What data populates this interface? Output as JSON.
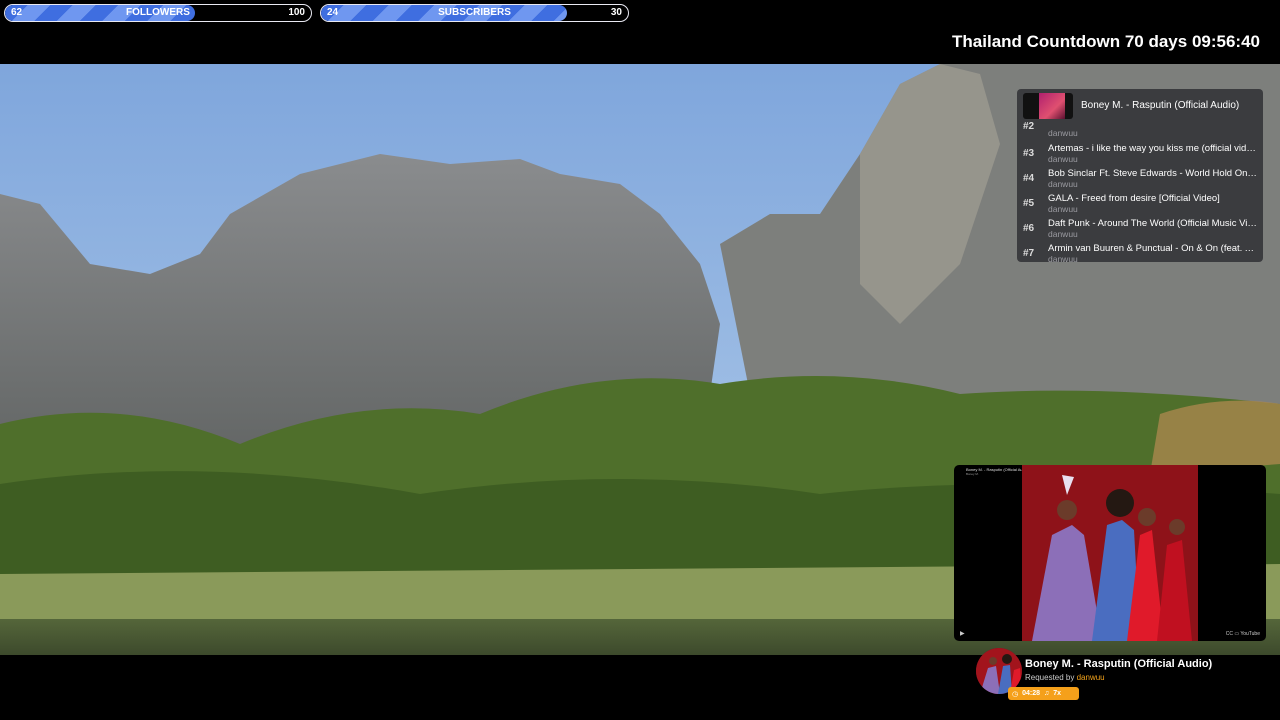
{
  "goals": {
    "followers": {
      "current": "62",
      "label": "FOLLOWERS",
      "max": "100",
      "progress": 0.62
    },
    "subscribers": {
      "current": "24",
      "label": "SUBSCRIBERS",
      "max": "30",
      "progress": 0.8
    }
  },
  "countdown": {
    "text": "Thailand Countdown 70 days 09:56:40"
  },
  "queue": {
    "now_playing": {
      "title": "Boney M. - Rasputin (Official Audio)"
    },
    "items": [
      {
        "num": "#2",
        "title": "",
        "user": "danwuu"
      },
      {
        "num": "#3",
        "title": "Artemas - i like the way you kiss me (official video)",
        "user": "danwuu"
      },
      {
        "num": "#4",
        "title": "Bob Sinclar Ft. Steve Edwards - World Hold On (Official Video)",
        "user": "danwuu"
      },
      {
        "num": "#5",
        "title": "GALA - Freed from desire [Official Video]",
        "user": "danwuu"
      },
      {
        "num": "#6",
        "title": "Daft Punk - Around The World (Official Music Video)",
        "user": "danwuu"
      },
      {
        "num": "#7",
        "title": "Armin van Buuren & Punctual - On & On (feat. Alika)",
        "user": "danwuu"
      }
    ]
  },
  "player": {
    "video_title": "Boney M. - Rasputin (Official Audio)",
    "video_sub": "Boney M.",
    "controls_right": "CC ▭ YouTube"
  },
  "now_card": {
    "title": "Boney M. - Rasputin (Official Audio)",
    "requested_prefix": "Requested by",
    "requested_user": "danwuu",
    "duration": "04:28",
    "plays": "7x"
  },
  "colors": {
    "accent": "#f5a01a",
    "goal_fill": "#3f6ee0",
    "background": "#000000"
  },
  "icons": [
    "clock-icon",
    "music-note-icon",
    "play-icon"
  ]
}
